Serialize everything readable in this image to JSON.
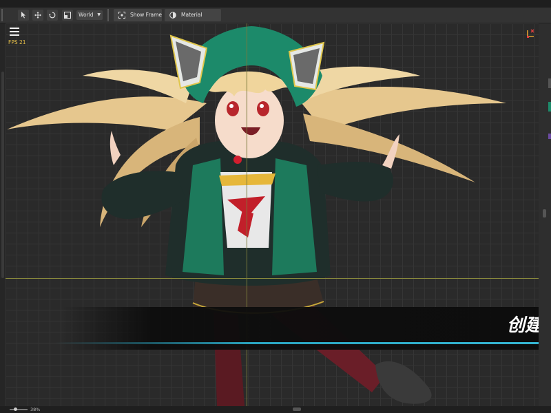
{
  "toolbar": {
    "space_select": "World",
    "show_frame_label": "Show Frame",
    "material_library_label": "Material Library"
  },
  "viewport": {
    "fps_label": "FPS 21",
    "banner_text": "创建你"
  },
  "status": {
    "zoom": "38%"
  },
  "colors": {
    "accent_cyan": "#2aa6c2",
    "fps_yellow": "#e8c14a",
    "hood_green": "#1c8a6a"
  }
}
